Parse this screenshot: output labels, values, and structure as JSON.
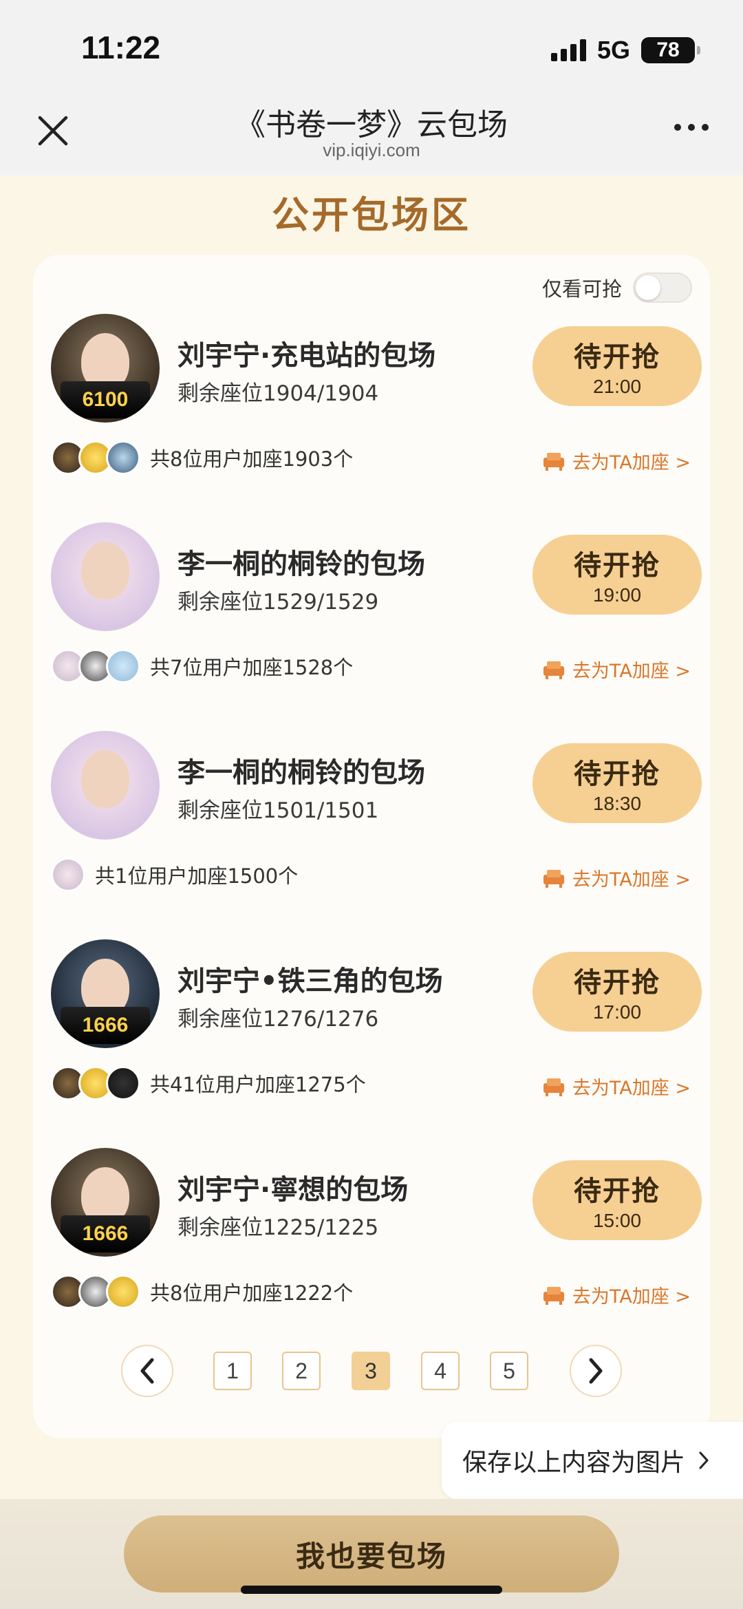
{
  "status": {
    "time": "11:22",
    "network": "5G",
    "battery": "78"
  },
  "nav": {
    "title": "《书卷一梦》云包场",
    "domain": "vip.iqiyi.com"
  },
  "section_title": "公开包场区",
  "filter": {
    "label": "仅看可抢",
    "enabled": false
  },
  "button_label": "待开抢",
  "join_label": "去为TA加座 >",
  "items": [
    {
      "avatar_badge": "6100",
      "title": "刘宇宁·充电站的包场",
      "seats": "剩余座位1904/1904",
      "time": "21:00",
      "users": "共8位用户加座1903个"
    },
    {
      "avatar_badge": "",
      "title": "李一桐的桐铃的包场",
      "seats": "剩余座位1529/1529",
      "time": "19:00",
      "users": "共7位用户加座1528个"
    },
    {
      "avatar_badge": "",
      "title": "李一桐的桐铃的包场",
      "seats": "剩余座位1501/1501",
      "time": "18:30",
      "users": "共1位用户加座1500个"
    },
    {
      "avatar_badge": "1666",
      "title": "刘宇宁•铁三角的包场",
      "seats": "剩余座位1276/1276",
      "time": "17:00",
      "users": "共41位用户加座1275个"
    },
    {
      "avatar_badge": "1666",
      "title": "刘宇宁·寧想的包场",
      "seats": "剩余座位1225/1225",
      "time": "15:00",
      "users": "共8位用户加座1222个"
    }
  ],
  "pagination": {
    "pages": [
      "1",
      "2",
      "3",
      "4",
      "5"
    ],
    "current": "3"
  },
  "save_image_label": "保存以上内容为图片",
  "cta_label": "我也要包场",
  "colors": {
    "accent": "#a56a2a",
    "button": "#f6cf92",
    "link": "#d9772b",
    "background": "#fbf6e6"
  }
}
